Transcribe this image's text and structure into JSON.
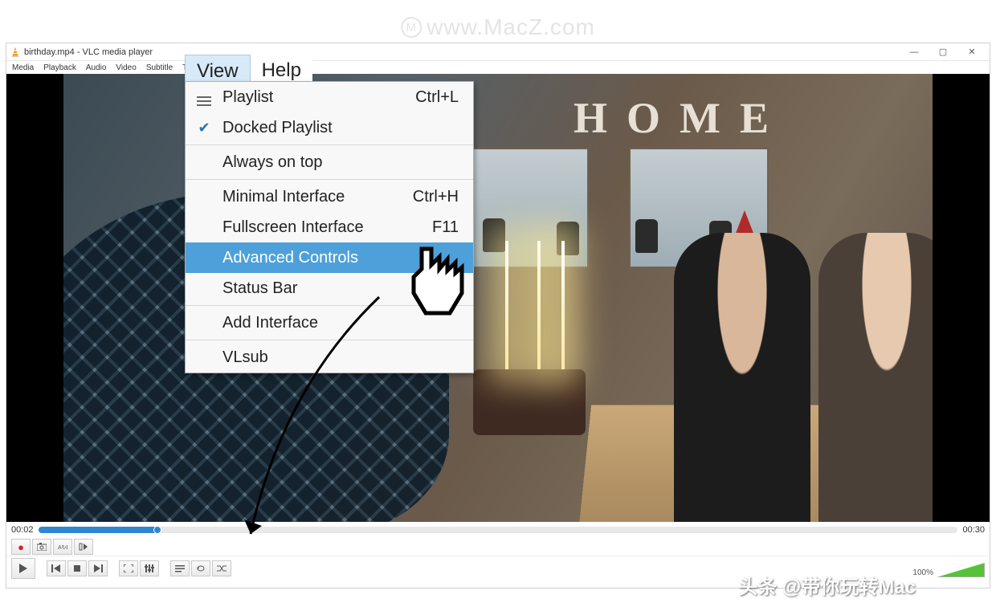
{
  "watermark": {
    "top": "www.MacZ.com",
    "bottom": "头条 @带你玩转Mac"
  },
  "window": {
    "title": "birthday.mp4 - VLC media player",
    "minimize": "—",
    "maximize": "▢",
    "close": "✕"
  },
  "menubar": {
    "items": [
      "Media",
      "Playback",
      "Audio",
      "Video",
      "Subtitle",
      "Tools",
      "View",
      "Help"
    ]
  },
  "open_menus": {
    "view": "View",
    "help": "Help"
  },
  "dropdown": {
    "items": [
      {
        "label": "Playlist",
        "shortcut": "Ctrl+L",
        "icon": "lines"
      },
      {
        "label": "Docked Playlist",
        "icon": "check"
      },
      {
        "sep": true
      },
      {
        "label": "Always on top"
      },
      {
        "sep": true
      },
      {
        "label": "Minimal Interface",
        "shortcut": "Ctrl+H"
      },
      {
        "label": "Fullscreen Interface",
        "shortcut": "F11"
      },
      {
        "label": "Advanced Controls",
        "hover": true
      },
      {
        "label": "Status Bar"
      },
      {
        "sep": true
      },
      {
        "label": "Add Interface"
      },
      {
        "sep": true
      },
      {
        "label": "VLsub"
      }
    ]
  },
  "video": {
    "home_text": "HOME"
  },
  "time": {
    "current": "00:02",
    "total": "00:30",
    "progress_pct": 13
  },
  "volume": {
    "label": "100%"
  }
}
